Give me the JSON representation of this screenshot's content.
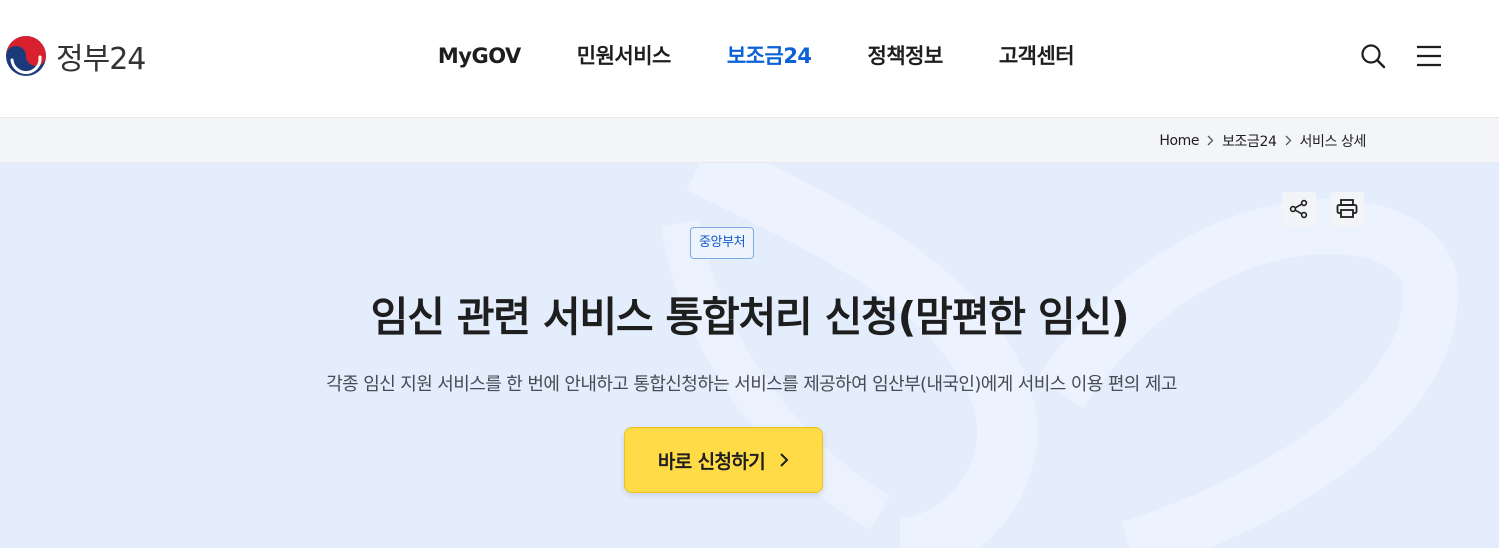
{
  "header": {
    "logo_text": "정부24",
    "logo_icon": "taegeuk-emblem-icon",
    "nav": [
      {
        "label": "MyGOV",
        "active": false
      },
      {
        "label": "민원서비스",
        "active": false
      },
      {
        "label": "보조금24",
        "active": true
      },
      {
        "label": "정책정보",
        "active": false
      },
      {
        "label": "고객센터",
        "active": false
      }
    ],
    "utility_icons": [
      "search-icon",
      "menu-icon"
    ]
  },
  "breadcrumb": {
    "items": [
      "Home",
      "보조금24",
      "서비스 상세"
    ]
  },
  "hero": {
    "badge": "중앙부처",
    "title": "임신 관련 서비스 통합처리 신청(맘편한 임신)",
    "description": "각종 임신 지원 서비스를 한 번에 안내하고 통합신청하는 서비스를 제공하여 임산부(내국인)에게 서비스 이용 편의 제고",
    "apply_label": "바로 신청하기",
    "action_icons": [
      "share-icon",
      "print-icon"
    ]
  },
  "colors": {
    "accent": "#0b62d6",
    "hero_bg": "#e3edfc",
    "apply_bg": "#ffdc47",
    "badge_border": "#7fa9e6"
  }
}
